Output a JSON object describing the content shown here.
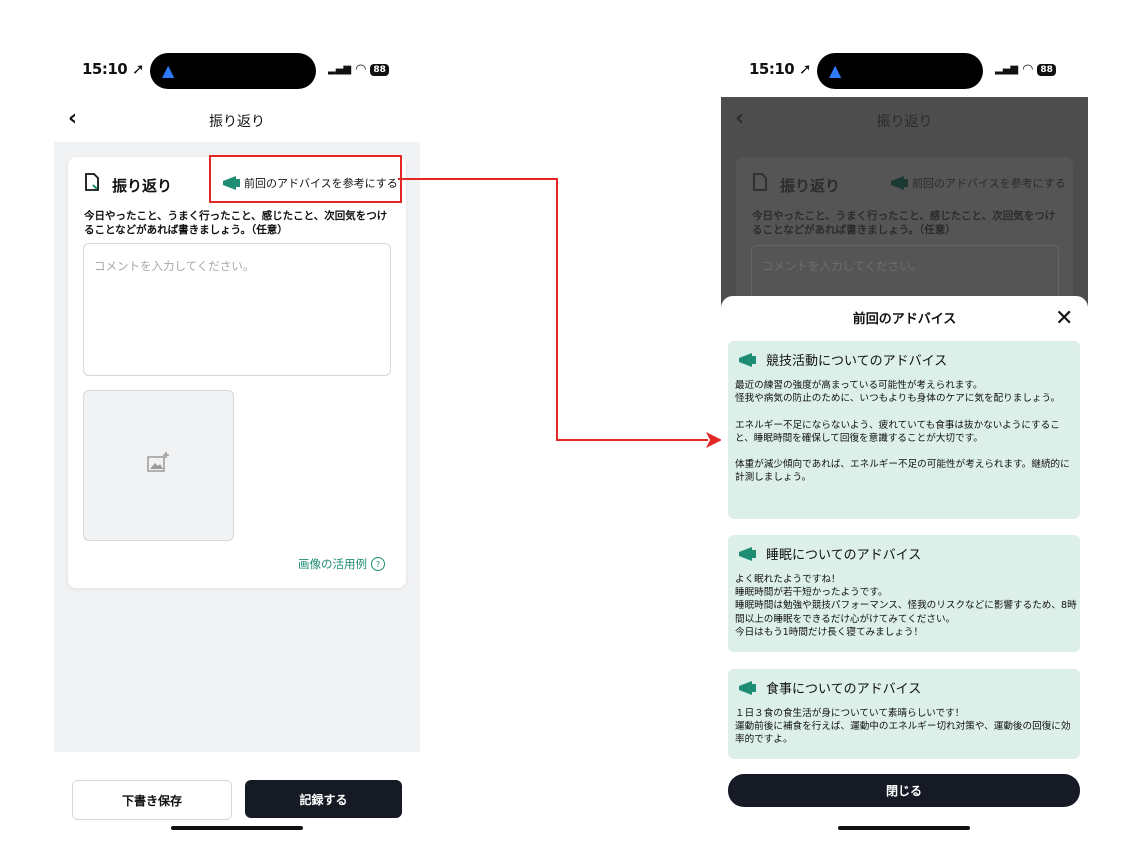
{
  "left": {
    "status_time": "15:10",
    "battery": "88",
    "nav_title": "振り返り",
    "card_title": "振り返り",
    "advice_link_label": "前回のアドバイスを参考にする",
    "description": "今日やったこと、うまく行ったこと、感じたこと、次回気をつけることなどがあれば書きましょう。（任意）",
    "comment_placeholder": "コメントを入力してください。",
    "image_examples_label": "画像の活用例",
    "draft_button": "下書き保存",
    "record_button": "記録する"
  },
  "right": {
    "status_time": "15:10",
    "battery": "88",
    "nav_title": "振り返り",
    "card_title": "振り返り",
    "advice_link_label": "前回のアドバイスを参考にする",
    "description": "今日やったこと、うまく行ったこと、感じたこと、次回気をつけることなどがあれば書きましょう。（任意）",
    "comment_placeholder": "コメントを入力してください。",
    "sheet_title": "前回のアドバイス",
    "advice": [
      {
        "title": "競技活動についてのアドバイス",
        "body": "最近の練習の強度が高まっている可能性が考えられます。\n怪我や病気の防止のために、いつもよりも身体のケアに気を配りましょう。\n\nエネルギー不足にならないよう、疲れていても食事は抜かないようにすること、睡眠時間を確保して回復を意識することが大切です。\n\n体重が減少傾向であれば、エネルギー不足の可能性が考えられます。継続的に計測しましょう。"
      },
      {
        "title": "睡眠についてのアドバイス",
        "body": "よく眠れたようですね！\n睡眠時間が若干短かったようです。\n睡眠時間は勉強や競技パフォーマンス、怪我のリスクなどに影響するため、8時間以上の睡眠をできるだけ心がけてみてください。\n今日はもう1時間だけ長く寝てみましょう！"
      },
      {
        "title": "食事についてのアドバイス",
        "body": "１日３食の食生活が身についていて素晴らしいです！\n運動前後に補食を行えば、運動中のエネルギー切れ対策や、運動後の回復に効率的ですよ。"
      }
    ],
    "close_button": "閉じる"
  },
  "colors": {
    "accent_green": "#1f8c74",
    "advice_card_bg": "#dcefe9",
    "dark_button": "#151a24",
    "highlight_red": "#e32626"
  },
  "icons": [
    "location-arrow-icon",
    "signal-icon",
    "wifi-icon",
    "battery-icon",
    "back-chevron-icon",
    "document-edit-icon",
    "megaphone-icon",
    "add-image-icon",
    "help-circle-icon",
    "close-icon"
  ]
}
